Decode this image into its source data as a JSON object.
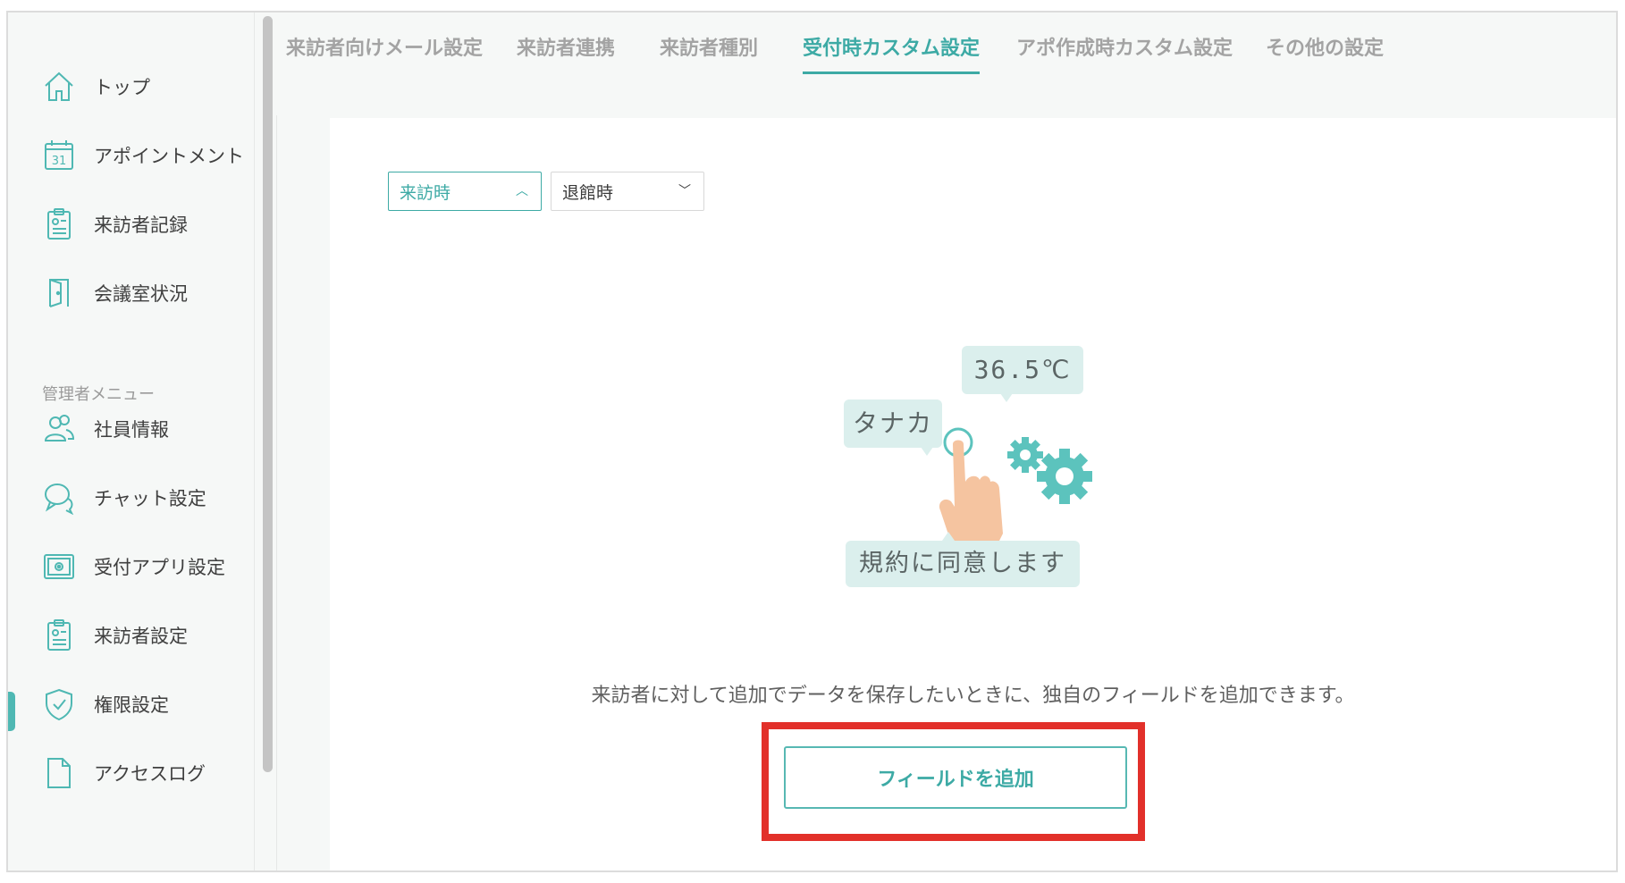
{
  "sidebar": {
    "items": [
      {
        "label": "トップ",
        "icon": "home-icon"
      },
      {
        "label": "アポイントメント",
        "icon": "calendar-icon"
      },
      {
        "label": "来訪者記録",
        "icon": "clipboard-icon"
      },
      {
        "label": "会議室状況",
        "icon": "door-icon"
      },
      {
        "label": "社員情報",
        "icon": "users-icon"
      },
      {
        "label": "チャット設定",
        "icon": "chat-icon"
      },
      {
        "label": "受付アプリ設定",
        "icon": "tablet-gear-icon"
      },
      {
        "label": "来訪者設定",
        "icon": "clipboard-icon"
      },
      {
        "label": "権限設定",
        "icon": "shield-check-icon"
      },
      {
        "label": "アクセスログ",
        "icon": "document-icon"
      }
    ],
    "section_label": "管理者メニュー",
    "active_index": 7
  },
  "tabs": [
    {
      "label": "来訪者向けメール設定"
    },
    {
      "label": "来訪者連携"
    },
    {
      "label": "来訪者種別"
    },
    {
      "label": "受付時カスタム設定"
    },
    {
      "label": "アポ作成時カスタム設定"
    },
    {
      "label": "その他の設定"
    }
  ],
  "active_tab_index": 3,
  "filters": {
    "primary": {
      "value": "来訪時",
      "chevron": "^"
    },
    "secondary": {
      "value": "退館時",
      "chevron": "v"
    }
  },
  "illustration": {
    "bubble_name": "タナカ",
    "bubble_temp": "36.5℃",
    "bubble_agree": "規約に同意します"
  },
  "description": "来訪者に対して追加でデータを保存したいときに、独自のフィールドを追加できます。",
  "add_field_button": "フィールドを追加",
  "colors": {
    "accent": "#3daaa5",
    "highlight": "#e2302a",
    "bubble": "#dbefed",
    "gear": "#5cc3bd",
    "hand": "#f5c4a0"
  }
}
